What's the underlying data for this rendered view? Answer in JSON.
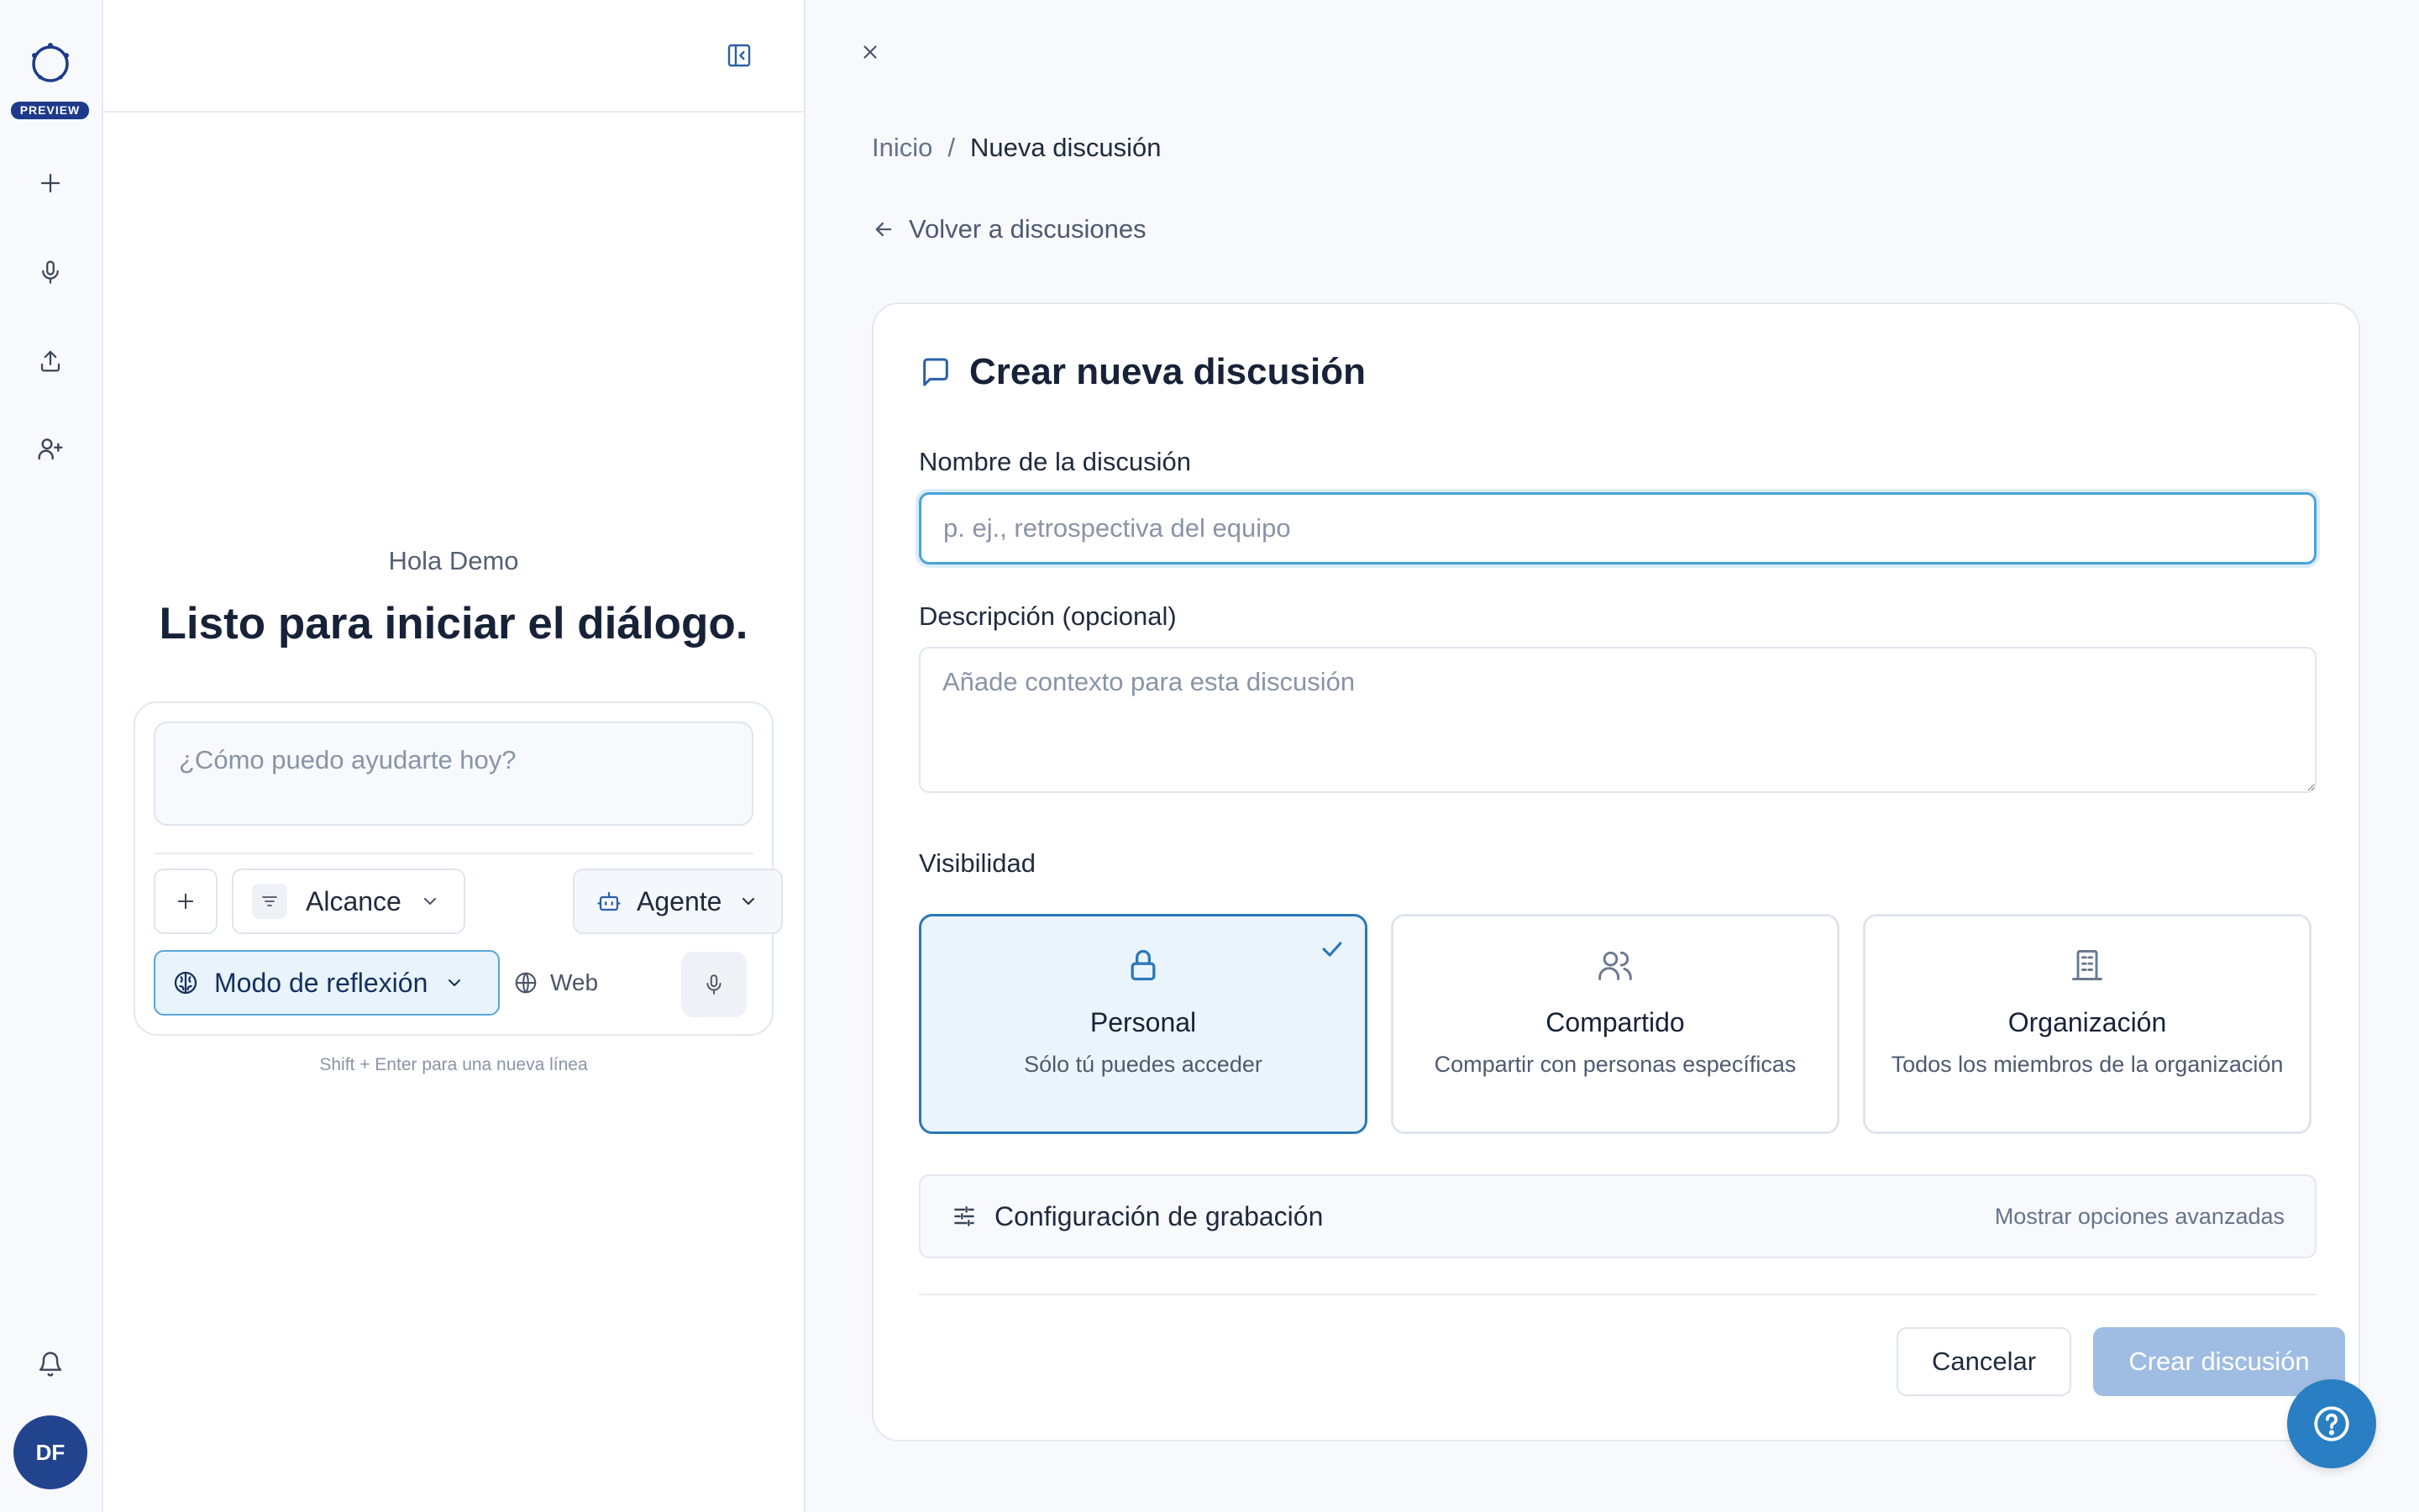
{
  "rail": {
    "preview_badge": "PREVIEW",
    "icons": [
      "plus-icon",
      "microphone-icon",
      "upload-icon",
      "add-user-icon",
      "bell-icon"
    ],
    "avatar_initials": "DF"
  },
  "chat": {
    "greeting": "Hola Demo",
    "headline": "Listo para iniciar el diálogo.",
    "prompt_placeholder": "¿Cómo puedo ayudarte hoy?",
    "scope_label": "Alcance",
    "agent_label": "Agente",
    "mode_label": "Modo de reflexión",
    "web_label": "Web",
    "hint": "Shift + Enter para una nueva línea"
  },
  "main": {
    "breadcrumb": {
      "home": "Inicio",
      "separator": "/",
      "current": "Nueva discusión"
    },
    "back_link": "Volver a discusiones",
    "card": {
      "title": "Crear nueva discusión",
      "name_label": "Nombre de la discusión",
      "name_placeholder": "p. ej., retrospectiva del equipo",
      "name_value": "",
      "desc_label": "Descripción (opcional)",
      "desc_placeholder": "Añade contexto para esta discusión",
      "visibility_label": "Visibilidad",
      "visibility_options": [
        {
          "title": "Personal",
          "desc": "Sólo tú puedes acceder",
          "icon": "lock-icon",
          "selected": true
        },
        {
          "title": "Compartido",
          "desc": "Compartir con personas específicas",
          "icon": "users-icon",
          "selected": false
        },
        {
          "title": "Organización",
          "desc": "Todos los miembros de la organización",
          "icon": "building-icon",
          "selected": false
        }
      ],
      "recording_label": "Configuración de grabación",
      "advanced_link": "Mostrar opciones avanzadas",
      "cancel_label": "Cancelar",
      "create_label": "Crear discusión"
    }
  },
  "colors": {
    "accent": "#2a7ec3",
    "selected_border": "#2a78b9",
    "brand_navy": "#1e3a8a",
    "disabled_button": "#9fbde2"
  }
}
